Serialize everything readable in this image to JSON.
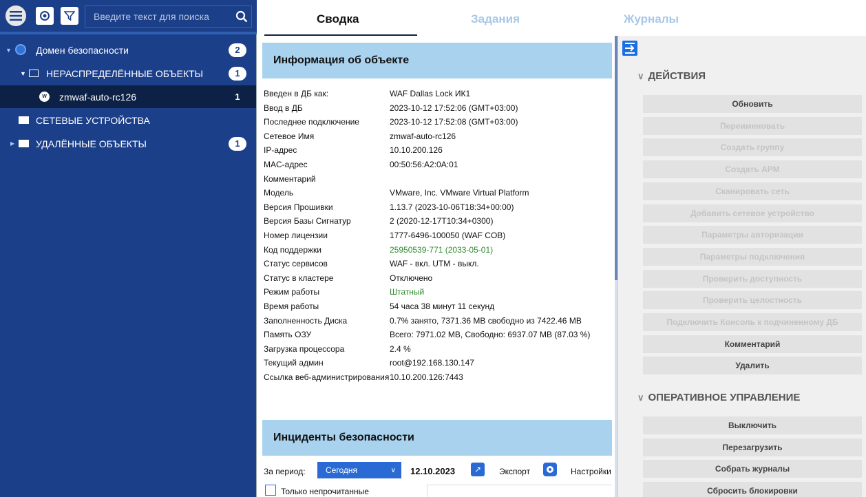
{
  "toolbar": {
    "search_placeholder": "Введите текст для поиска"
  },
  "tree": [
    {
      "label": "Домен безопасности",
      "count": "2"
    },
    {
      "label": "НЕРАСПРЕДЕЛЁННЫЕ ОБЪЕКТЫ",
      "count": "1"
    },
    {
      "label": "zmwaf-auto-rc126",
      "count": "1"
    },
    {
      "label": "СЕТЕВЫЕ УСТРОЙСТВА",
      "count": ""
    },
    {
      "label": "УДАЛЁННЫЕ ОБЪЕКТЫ",
      "count": "1"
    }
  ],
  "tabs": [
    "Сводка",
    "Задания",
    "Журналы"
  ],
  "info": {
    "title": "Информация об объекте",
    "rows": [
      {
        "k": "Введен в ДБ как:",
        "v": "WAF Dallas Lock ИК1"
      },
      {
        "k": "Ввод в ДБ",
        "v": "2023-10-12 17:52:06 (GMT+03:00)"
      },
      {
        "k": "Последнее подключение",
        "v": "2023-10-12 17:52:08 (GMT+03:00)"
      },
      {
        "k": "Сетевое Имя",
        "v": "zmwaf-auto-rc126"
      },
      {
        "k": "IP-адрес",
        "v": "10.10.200.126"
      },
      {
        "k": "MAC-адрес",
        "v": "00:50:56:A2:0A:01"
      },
      {
        "k": "Комментарий",
        "v": ""
      },
      {
        "k": "Модель",
        "v": "VMware, Inc. VMware Virtual Platform"
      },
      {
        "k": "Версия Прошивки",
        "v": "1.13.7 (2023-10-06T18:34+00:00)"
      },
      {
        "k": "Версия Базы Сигнатур",
        "v": "2 (2020-12-17T10:34+0300)"
      },
      {
        "k": "Номер лицензии",
        "v": "1777-6496-100050 (WAF COB)"
      },
      {
        "k": "Код поддержки",
        "v": "25950539-771 (2033-05-01)"
      },
      {
        "k": "Статус сервисов",
        "v": "WAF - вкл. UTM - выкл."
      },
      {
        "k": "Статус в кластере",
        "v": "Отключено"
      },
      {
        "k": "Режим работы",
        "v": "Штатный"
      },
      {
        "k": "Время работы",
        "v": "54 часа 38 минут 11 секунд"
      },
      {
        "k": "Заполненность Диска",
        "v": "0.7% занято, 7371.36 MB свободно из 7422.46 MB"
      },
      {
        "k": "Память ОЗУ",
        "v": "Всего: 7971.02 MB, Свободно: 6937.07 MB (87.03 %)"
      },
      {
        "k": "Загрузка процессора",
        "v": "2.4 %"
      },
      {
        "k": "Текущий админ",
        "v": "root@192.168.130.147"
      },
      {
        "k": "Ссылка веб-администрирования",
        "v": "10.10.200.126:7443"
      }
    ]
  },
  "incidents": {
    "title": "Инциденты безопасности",
    "period_label": "За период:",
    "period_value": "Сегодня",
    "date": "12.10.2023",
    "export_label": "Экспорт",
    "settings_label": "Настройки",
    "unread_label": "Только непрочитанные"
  },
  "actions": {
    "title": "ДЕЙСТВИЯ",
    "items": [
      {
        "label": "Обновить",
        "enabled": true
      },
      {
        "label": "Переименовать",
        "enabled": false
      },
      {
        "label": "Создать группу",
        "enabled": false
      },
      {
        "label": "Создать АРМ",
        "enabled": false
      },
      {
        "label": "Сканировать сеть",
        "enabled": false
      },
      {
        "label": "Добавить сетевое устройство",
        "enabled": false
      },
      {
        "label": "Параметры авторизации",
        "enabled": false
      },
      {
        "label": "Параметры подключения",
        "enabled": false
      },
      {
        "label": "Проверить доступность",
        "enabled": false
      },
      {
        "label": "Проверить целостность",
        "enabled": false
      },
      {
        "label": "Подключить Консоль к подчиненному ДБ",
        "enabled": false
      },
      {
        "label": "Комментарий",
        "enabled": true
      },
      {
        "label": "Удалить",
        "enabled": true
      }
    ]
  },
  "ops": {
    "title": "ОПЕРАТИВНОЕ УПРАВЛЕНИЕ",
    "items": [
      {
        "label": "Выключить",
        "enabled": true
      },
      {
        "label": "Перезагрузить",
        "enabled": true
      },
      {
        "label": "Собрать журналы",
        "enabled": true
      },
      {
        "label": "Сбросить блокировки",
        "enabled": true
      }
    ]
  },
  "colors": {
    "sidebar": "#1c3f8a",
    "selected": "#0c2145",
    "section_header": "#a9d2ee",
    "accent": "#2a6ad4",
    "green": "#2e8b2e"
  }
}
